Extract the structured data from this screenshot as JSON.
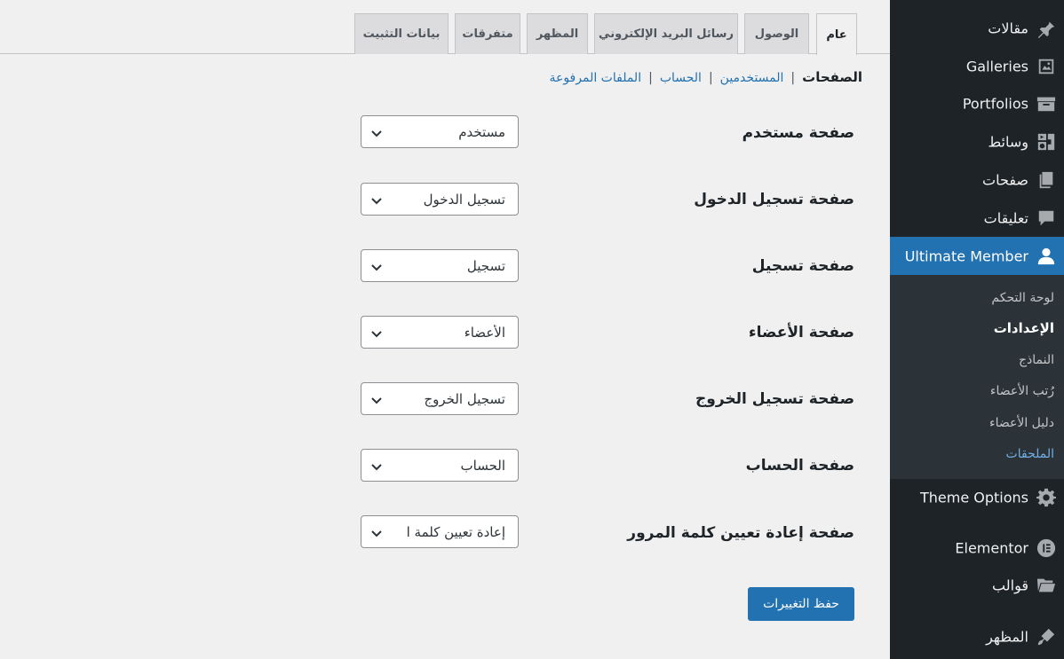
{
  "sidebar": {
    "items": [
      {
        "label": "مقالات",
        "icon": "pin-icon"
      },
      {
        "label": "Galleries",
        "icon": "gallery-icon"
      },
      {
        "label": "Portfolios",
        "icon": "portfolio-icon"
      },
      {
        "label": "وسائط",
        "icon": "media-icon"
      },
      {
        "label": "صفحات",
        "icon": "pages-icon"
      },
      {
        "label": "تعليقات",
        "icon": "comment-icon"
      },
      {
        "label": "Ultimate Member",
        "icon": "user-icon"
      },
      {
        "label": "Theme Options",
        "icon": "gear-icon"
      },
      {
        "label": "Elementor",
        "icon": "elementor-icon"
      },
      {
        "label": "قوالب",
        "icon": "folder-icon"
      },
      {
        "label": "المظهر",
        "icon": "appearance-icon"
      }
    ],
    "submenu": [
      {
        "label": "لوحة التحكم"
      },
      {
        "label": "الإعدادات"
      },
      {
        "label": "النماذج"
      },
      {
        "label": "رُتب الأعضاء"
      },
      {
        "label": "دليل الأعضاء"
      },
      {
        "label": "الملحقات"
      }
    ]
  },
  "tabs": [
    {
      "label": "عام"
    },
    {
      "label": "الوصول"
    },
    {
      "label": "رسائل البريد الإلكتروني"
    },
    {
      "label": "المظهر"
    },
    {
      "label": "متفرقات"
    },
    {
      "label": "بيانات التثبيت"
    }
  ],
  "subnav": {
    "current": "الصفحات",
    "links": [
      "المستخدمين",
      "الحساب",
      "الملفات المرفوعة"
    ],
    "separator": "|"
  },
  "fields": [
    {
      "label": "صفحة مستخدم",
      "value": "مستخدم"
    },
    {
      "label": "صفحة تسجيل الدخول",
      "value": "تسجيل الدخول"
    },
    {
      "label": "صفحة تسجيل",
      "value": "تسجيل"
    },
    {
      "label": "صفحة الأعضاء",
      "value": "الأعضاء"
    },
    {
      "label": "صفحة تسجيل الخروج",
      "value": "تسجيل الخروج"
    },
    {
      "label": "صفحة الحساب",
      "value": "الحساب"
    },
    {
      "label": "صفحة إعادة تعيين كلمة المرور",
      "value": "إعادة تعيين كلمة ا"
    }
  ],
  "save_label": "حفظ التغييرات",
  "colors": {
    "sidebar_bg": "#1d2327",
    "submenu_bg": "#2c3338",
    "accent": "#2271b1",
    "link": "#2271b1",
    "submenu_highlight": "#72aee6"
  }
}
